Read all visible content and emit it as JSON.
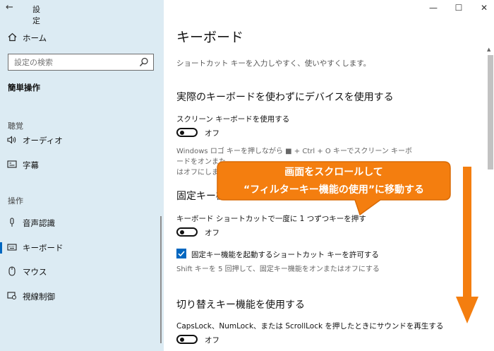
{
  "window": {
    "back_glyph": "←",
    "title": "設定",
    "minimize": "—",
    "maximize": "☐",
    "close": "✕"
  },
  "sidebar": {
    "home": "ホーム",
    "search_placeholder": "設定の検索",
    "section": "簡単操作",
    "groups": [
      {
        "label": "聴覚",
        "items": [
          {
            "label": "オーディオ",
            "icon": "speaker-icon"
          },
          {
            "label": "字幕",
            "icon": "captions-icon"
          }
        ]
      },
      {
        "label": "操作",
        "items": [
          {
            "label": "音声認識",
            "icon": "microphone-icon"
          },
          {
            "label": "キーボード",
            "icon": "keyboard-icon",
            "selected": true
          },
          {
            "label": "マウス",
            "icon": "mouse-icon"
          },
          {
            "label": "視線制御",
            "icon": "eye-icon"
          }
        ]
      }
    ]
  },
  "main": {
    "title": "キーボード",
    "subtitle": "ショートカット キーを入力しやすく、使いやすくします。",
    "onscreen": {
      "heading": "実際のキーボードを使わずにデバイスを使用する",
      "toggle_label": "スクリーン キーボードを使用する",
      "toggle_state": "オフ",
      "note_line1": "Windows ロゴ キーを押しながら ■ + Ctrl + O キーでスクリーン キーボードをオンまた",
      "note_line2": "はオフにします。"
    },
    "sticky": {
      "heading_visible": "固定キー機",
      "toggle_label": "キーボード ショートカットで一度に 1 つずつキーを押す",
      "toggle_state": "オフ",
      "checkbox_label": "固定キー機能を起動するショートカット キーを許可する",
      "checkbox_checked": true,
      "note": "Shift キーを 5 回押して、固定キー機能をオンまたはオフにする"
    },
    "toggle_keys": {
      "heading": "切り替えキー機能を使用する",
      "toggle_label": "CapsLock、NumLock、または ScrollLock を押したときにサウンドを再生する",
      "toggle_state": "オフ"
    }
  },
  "callout": {
    "line1": "画面をスクロールして",
    "line2": "“フィルターキー機能の使用”に移動する"
  },
  "colors": {
    "sidebar_bg": "#dcebf3",
    "accent": "#0067c0",
    "callout_fill": "#f47e0f",
    "callout_border": "#d96a05",
    "arrow": "#f47e0f"
  }
}
